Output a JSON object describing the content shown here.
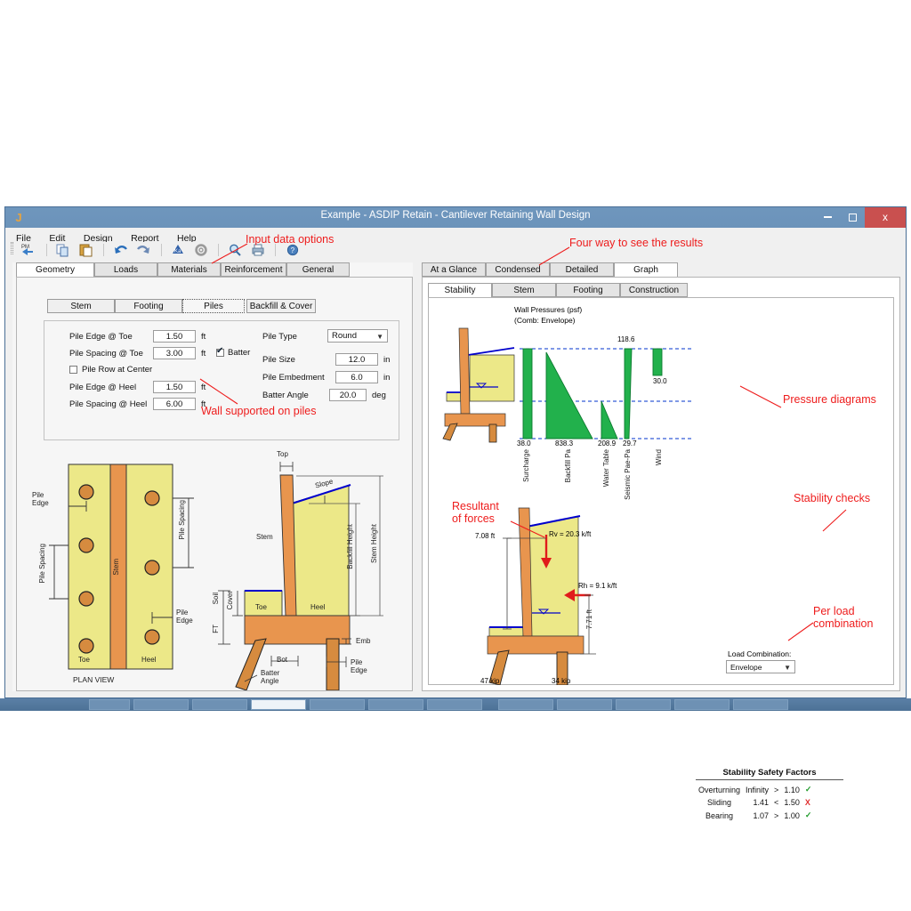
{
  "window": {
    "title": "Example - ASDIP Retain - Cantilever Retaining Wall Design",
    "app_icon": "J",
    "minimize": "minimize-icon",
    "maximize": "maximize-icon",
    "close_label": "x"
  },
  "menu": [
    "File",
    "Edit",
    "Design",
    "Report",
    "Help"
  ],
  "toolbar_icons": [
    "project-manager-back-icon",
    "copy-icon",
    "paste-icon",
    "undo-icon",
    "redo-icon",
    "design-ka-icon",
    "settings-gear-icon",
    "zoom-icon",
    "print-icon",
    "help-icon"
  ],
  "left": {
    "tabs": [
      {
        "label": "Geometry",
        "selected": true
      },
      {
        "label": "Loads",
        "selected": false
      },
      {
        "label": "Materials",
        "selected": false
      },
      {
        "label": "Reinforcement",
        "selected": false
      },
      {
        "label": "General",
        "selected": false
      }
    ],
    "section_buttons": [
      {
        "label": "Stem",
        "active": false
      },
      {
        "label": "Footing",
        "active": false
      },
      {
        "label": "Piles",
        "active": true
      },
      {
        "label": "Backfill & Cover",
        "active": false
      }
    ],
    "fields_left": [
      {
        "label": "Pile Edge @ Toe",
        "value": "1.50",
        "unit": "ft"
      },
      {
        "label": "Pile Spacing @ Toe",
        "value": "3.00",
        "unit": "ft"
      },
      {
        "label": "Pile Edge @ Heel",
        "value": "1.50",
        "unit": "ft"
      },
      {
        "label": "Pile Spacing @ Heel",
        "value": "6.00",
        "unit": "ft"
      }
    ],
    "checkbox_pile_row_center": {
      "label": "Pile Row at Center",
      "checked": false
    },
    "checkbox_batter": {
      "label": "Batter",
      "checked": true
    },
    "fields_right": [
      {
        "label": "Pile Type",
        "value": "Round",
        "unit": "",
        "type": "combo"
      },
      {
        "label": "Pile Size",
        "value": "12.0",
        "unit": "in",
        "type": "text"
      },
      {
        "label": "Pile Embedment",
        "value": "6.0",
        "unit": "in",
        "type": "text"
      },
      {
        "label": "Batter Angle",
        "value": "20.0",
        "unit": "deg",
        "type": "text"
      }
    ]
  },
  "plan_view": {
    "caption": "PLAN VIEW",
    "labels": {
      "toe": "Toe",
      "heel": "Heel",
      "stem": "Stem",
      "pile_edge": "Pile\nEdge",
      "pile_spacing": "Pile Spacing"
    }
  },
  "section_view": {
    "labels": {
      "top": "Top",
      "slope": "Slope",
      "stem": "Stem",
      "toe": "Toe",
      "heel": "Heel",
      "backfill_height": "Backfill Height",
      "stem_height": "Stem Height",
      "soil": "Soil",
      "cover": "Cover",
      "ft": "FT",
      "bot": "Bot",
      "emb": "Emb",
      "batter_angle": "Batter\nAngle",
      "pile_edge": "Pile\nEdge"
    }
  },
  "right": {
    "tabs": [
      {
        "label": "At a Glance",
        "selected": false
      },
      {
        "label": "Condensed",
        "selected": false
      },
      {
        "label": "Detailed",
        "selected": false
      },
      {
        "label": "Graph",
        "selected": true
      }
    ],
    "subtabs": [
      {
        "label": "Stability",
        "selected": true
      },
      {
        "label": "Stem",
        "selected": false
      },
      {
        "label": "Footing",
        "selected": false
      },
      {
        "label": "Construction",
        "selected": false
      }
    ]
  },
  "chart_data": {
    "type": "bar",
    "title": "Wall Pressures (psf)",
    "subtitle": "(Comb: Envelope)",
    "categories": [
      "Surcharge",
      "Backfill Pa",
      "Water Table",
      "Seismic Pae-Pa",
      "Wind"
    ],
    "values": [
      38.0,
      838.3,
      208.9,
      29.7,
      30.0
    ],
    "value_labels": [
      "38.0",
      "838.3",
      "208.9",
      "29.7",
      "30.0"
    ],
    "top_label": "118.6",
    "xlabel": "",
    "ylabel": "psf",
    "grid": true,
    "legend": "none"
  },
  "resultant": {
    "rv_label": "Rv = 20.3 k/ft",
    "rh_label": "Rh = 9.1 k/ft",
    "arm_label": "7.08 ft",
    "height_label": "7.71 ft",
    "toe_pile_reaction": "47 kip",
    "heel_pile_reaction": "34 kip"
  },
  "stability": {
    "heading": "Stability Safety Factors",
    "rows": [
      {
        "name": "Overturning",
        "value": "Infinity",
        "op": ">",
        "limit": "1.10",
        "status": "ok"
      },
      {
        "name": "Sliding",
        "value": "1.41",
        "op": "<",
        "limit": "1.50",
        "status": "bad"
      },
      {
        "name": "Bearing",
        "value": "1.07",
        "op": ">",
        "limit": "1.00",
        "status": "ok"
      }
    ],
    "ok_mark": "✓",
    "bad_mark": "X"
  },
  "load_combination": {
    "label": "Load Combination:",
    "value": "Envelope"
  },
  "annotations": [
    {
      "id": "input-data-options",
      "text": "Input data options"
    },
    {
      "id": "four-way-results",
      "text": "Four way to see the results"
    },
    {
      "id": "wall-supported-on-piles",
      "text": "Wall supported on piles"
    },
    {
      "id": "pressure-diagrams",
      "text": "Pressure diagrams"
    },
    {
      "id": "resultant-of-forces",
      "text": "Resultant\nof forces"
    },
    {
      "id": "stability-checks",
      "text": "Stability checks"
    },
    {
      "id": "per-load-combination",
      "text": "Per load\ncombination"
    }
  ],
  "colors": {
    "concrete": "#e8954e",
    "soil": "#ece888",
    "pressure": "#22b14c",
    "water": "#0000cc",
    "annotation": "#ee1c1c",
    "titlebar": "#6f96bd",
    "close": "#c9504f"
  }
}
